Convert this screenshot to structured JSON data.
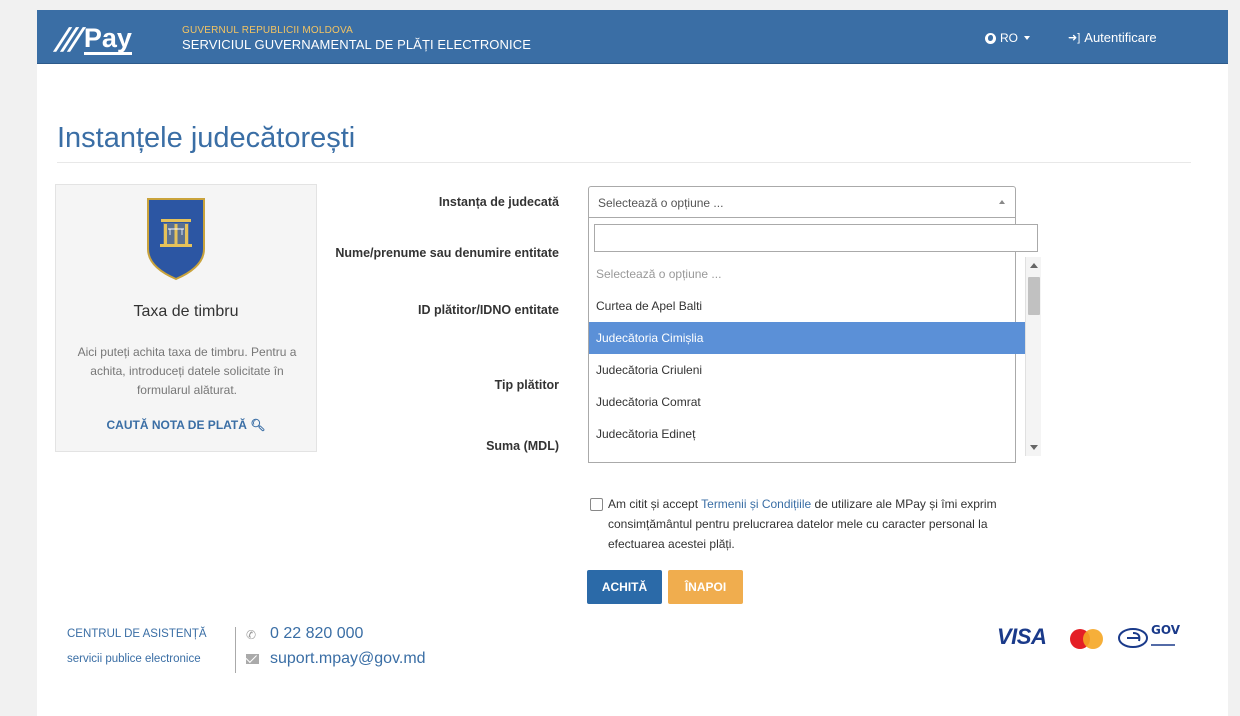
{
  "header": {
    "logo_text": "Pay",
    "gov_line1": "GUVERNUL REPUBLICII MOLDOVA",
    "gov_line2": "SERVICIUL GUVERNAMENTAL DE PLĂȚI ELECTRONICE",
    "language": "RO",
    "login": "Autentificare"
  },
  "page": {
    "title": "Instanțele judecătorești"
  },
  "card": {
    "title": "Taxa de timbru",
    "description": "Aici puteți achita taxa de timbru. Pentru a achita, introduceți datele solicitate în formularul alăturat.",
    "link": "CAUTĂ NOTA DE PLATĂ"
  },
  "form": {
    "labels": {
      "court": "Instanța de judecată",
      "name": "Nume/prenume sau denumire entitate",
      "payer_id": "ID plătitor/IDNO entitate",
      "payer_type": "Tip plătitor",
      "amount": "Suma (MDL)"
    },
    "court_select": {
      "value": "Selectează o opțiune ...",
      "search_value": "",
      "options": [
        "Selectează o opțiune ...",
        "Curtea de Apel Balti",
        "Judecătoria Cimișlia",
        "Judecătoria Criuleni",
        "Judecătoria Comrat",
        "Judecătoria Edineț"
      ],
      "highlighted": "Judecătoria Cimișlia"
    },
    "terms": {
      "before": "Am citit și accept ",
      "link": "Termenii și Condițiile",
      "after": " de utilizare ale MPay și îmi exprim consimțământul pentru prelucrarea datelor mele cu caracter personal la efectuarea acestei plăți.",
      "checked": false
    },
    "buttons": {
      "pay": "ACHITĂ",
      "back": "ÎNAPOI"
    }
  },
  "footer": {
    "support_line1": "CENTRUL DE ASISTENȚĂ",
    "support_line2": "servicii publice electronice",
    "phone": "0 22 820 000",
    "email": "suport.mpay@gov.md",
    "payment_logos": [
      "VISA",
      "mastercard",
      "eGOV"
    ],
    "visa_text": "VISA",
    "egov_text": "GOV"
  },
  "colors": {
    "header_bg": "#3a6ea5",
    "accent": "#3a6ea5",
    "highlight": "#5b90d7",
    "pay_button": "#2b6aa8",
    "back_button": "#f0ad4e",
    "gov_line1": "#f3c463"
  }
}
